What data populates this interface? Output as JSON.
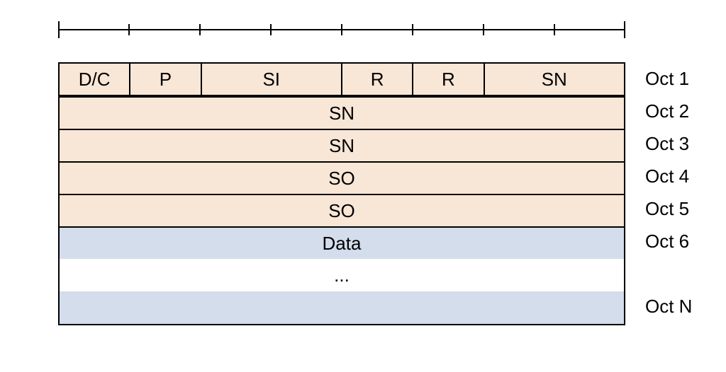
{
  "ruler": {
    "bits": 8
  },
  "header": {
    "row1_fields": [
      {
        "label": "D/C",
        "bits": 1
      },
      {
        "label": "P",
        "bits": 1
      },
      {
        "label": "SI",
        "bits": 2
      },
      {
        "label": "R",
        "bits": 1
      },
      {
        "label": "R",
        "bits": 1
      },
      {
        "label": "SN",
        "bits": 2
      }
    ],
    "rows": [
      "SN",
      "SN",
      "SO",
      "SO"
    ]
  },
  "data_section": {
    "first": "Data",
    "ellipsis": "..."
  },
  "octet_labels": [
    "Oct 1",
    "Oct 2",
    "Oct 3",
    "Oct 4",
    "Oct 5",
    "Oct 6",
    "Oct N"
  ],
  "colors": {
    "header_bg": "#f8e6d6",
    "data_bg": "#d3ddeb",
    "gap_bg": "#ffffff",
    "border": "#000000"
  }
}
